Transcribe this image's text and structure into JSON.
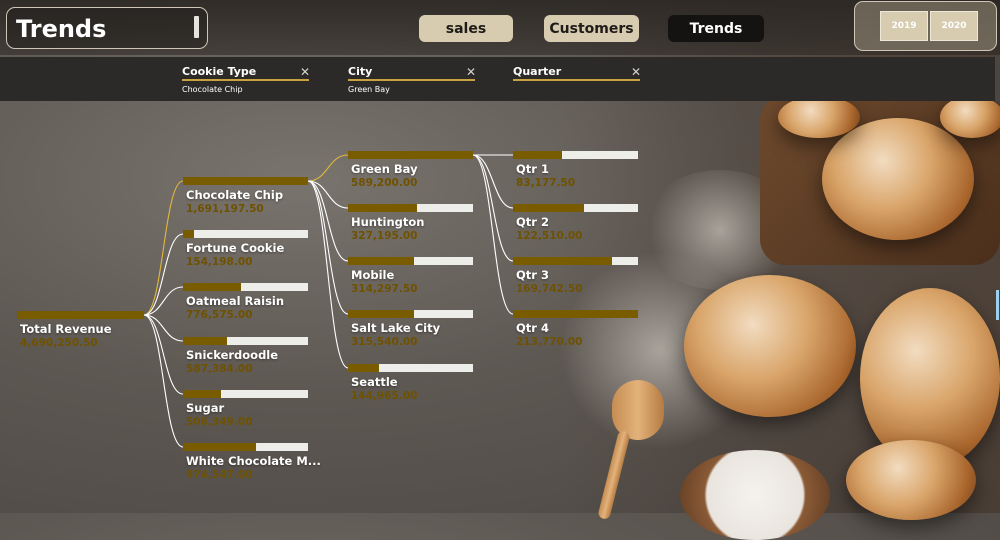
{
  "header": {
    "title": "Trends",
    "nav": [
      {
        "label": "sales"
      },
      {
        "label": "Customers"
      },
      {
        "label": "Trends"
      }
    ],
    "years": [
      "2019",
      "2020"
    ]
  },
  "filters": [
    {
      "label": "Cookie Type",
      "value": "Chocolate Chip"
    },
    {
      "label": "City",
      "value": "Green Bay"
    },
    {
      "label": "Quarter",
      "value": ""
    }
  ],
  "tree": {
    "root": {
      "label": "Total Revenue",
      "value": "4,690,250.50",
      "fraction": 1.0
    },
    "level1": [
      {
        "label": "Chocolate Chip",
        "value": "1,691,197.50",
        "fraction": 1.0
      },
      {
        "label": "Fortune Cookie",
        "value": "154,198.00",
        "fraction": 0.09
      },
      {
        "label": "Oatmeal Raisin",
        "value": "776,575.00",
        "fraction": 0.46
      },
      {
        "label": "Snickerdoodle",
        "value": "587,384.00",
        "fraction": 0.35
      },
      {
        "label": "Sugar",
        "value": "506,349.00",
        "fraction": 0.3
      },
      {
        "label": "White Chocolate M...",
        "value": "974,547.00",
        "fraction": 0.58
      }
    ],
    "level2": [
      {
        "label": "Green Bay",
        "value": "589,200.00",
        "fraction": 1.0
      },
      {
        "label": "Huntington",
        "value": "327,195.00",
        "fraction": 0.55
      },
      {
        "label": "Mobile",
        "value": "314,297.50",
        "fraction": 0.53
      },
      {
        "label": "Salt Lake City",
        "value": "315,540.00",
        "fraction": 0.53
      },
      {
        "label": "Seattle",
        "value": "144,965.00",
        "fraction": 0.25
      }
    ],
    "level3": [
      {
        "label": "Qtr 1",
        "value": "83,177.50",
        "fraction": 0.39
      },
      {
        "label": "Qtr 2",
        "value": "122,510.00",
        "fraction": 0.57
      },
      {
        "label": "Qtr 3",
        "value": "169,742.50",
        "fraction": 0.79
      },
      {
        "label": "Qtr 4",
        "value": "213,770.00",
        "fraction": 1.0
      }
    ]
  },
  "colors": {
    "bar_fill": "#7a5c00",
    "bar_track": "#ededea",
    "connector_active": "#e0b73a",
    "connector": "#ffffff"
  }
}
